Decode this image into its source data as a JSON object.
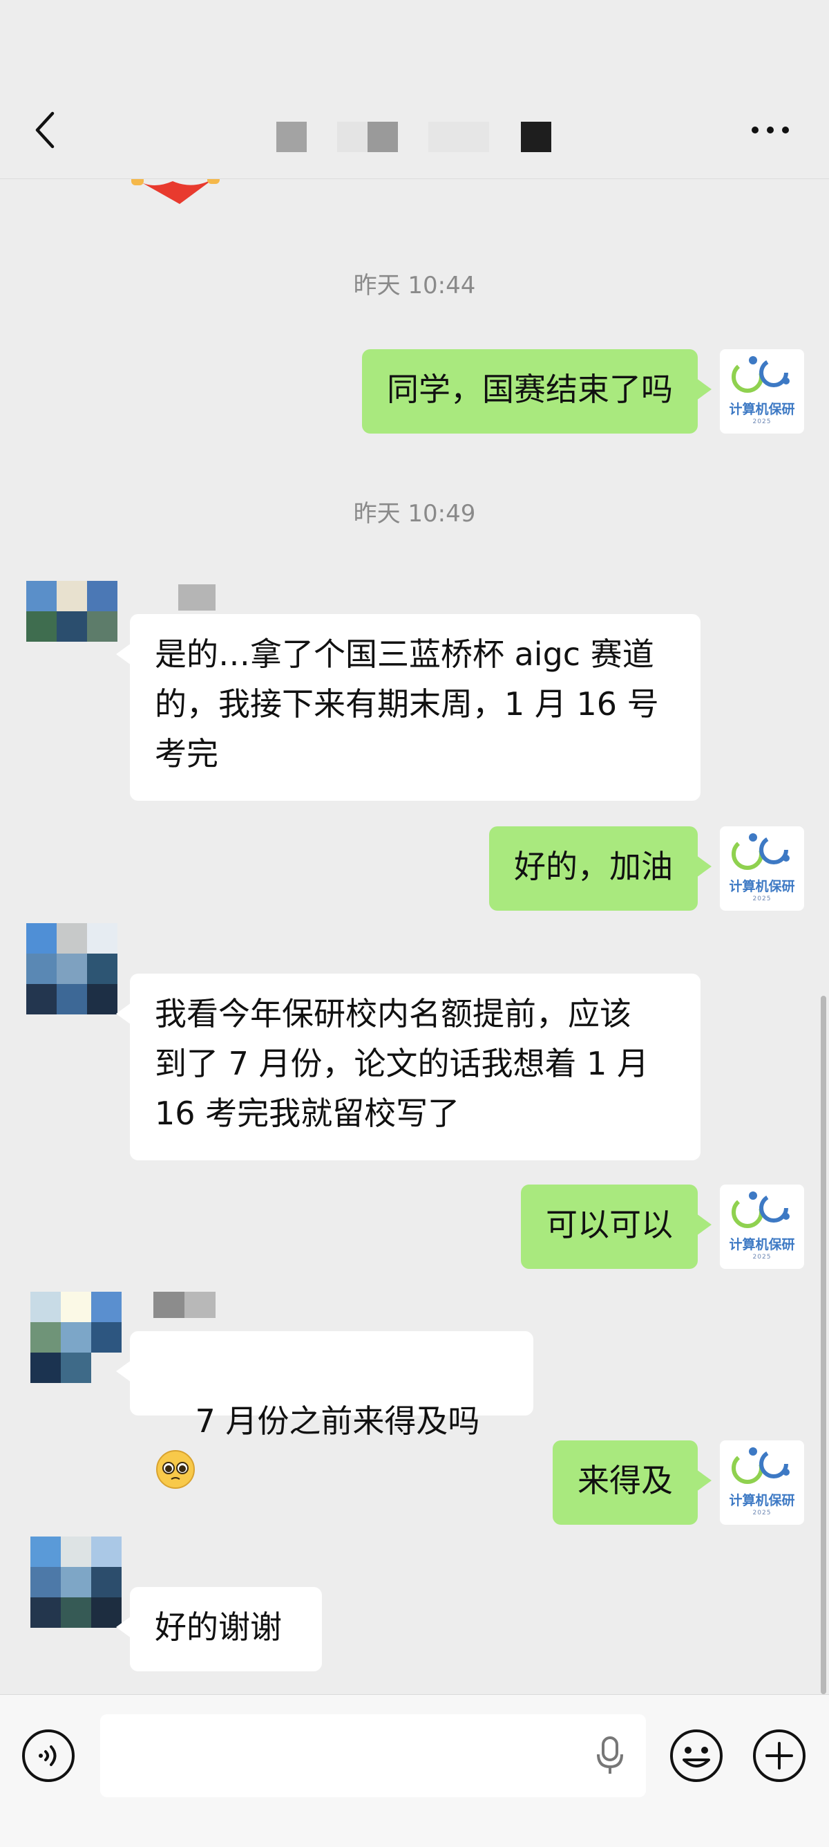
{
  "header": {
    "back_icon": "chevron-left-icon",
    "more_icon": "more-horizontal-icon"
  },
  "self_avatar": {
    "text": "计算机保研",
    "sub": "2025"
  },
  "messages": [
    {
      "type": "timestamp",
      "text": "昨天 10:44"
    },
    {
      "type": "outgoing",
      "text": "同学，国赛结束了吗"
    },
    {
      "type": "timestamp",
      "text": "昨天 10:49"
    },
    {
      "type": "incoming",
      "text": "是的…拿了个国三蓝桥杯 aigc 赛道\n的，我接下来有期末周，1 月 16 号\n考完"
    },
    {
      "type": "outgoing",
      "text": "好的，加油"
    },
    {
      "type": "incoming",
      "text": "我看今年保研校内名额提前，应该\n到了 7 月份，论文的话我想着 1 月\n16 考完我就留校写了"
    },
    {
      "type": "outgoing",
      "text": "可以可以"
    },
    {
      "type": "incoming",
      "text": "7 月份之前来得及吗",
      "emoji": "pleading-face-emoji"
    },
    {
      "type": "outgoing",
      "text": "来得及"
    },
    {
      "type": "incoming",
      "text": "好的谢谢"
    }
  ],
  "input_bar": {
    "voice_icon": "voice-mode-icon",
    "mic_icon": "microphone-icon",
    "emoji_icon": "emoji-icon",
    "plus_icon": "plus-icon",
    "message_value": ""
  },
  "colors": {
    "outgoing_bubble": "#a9e97e",
    "incoming_bubble": "#ffffff",
    "background": "#ededed"
  }
}
